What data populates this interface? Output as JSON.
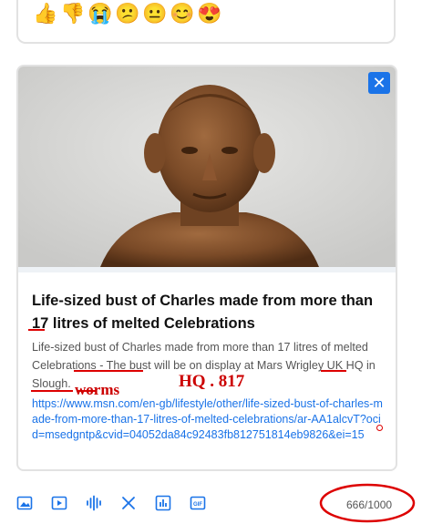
{
  "reactions": [
    {
      "name": "thumbs-up",
      "glyph": "👍"
    },
    {
      "name": "thumbs-down",
      "glyph": "👎"
    },
    {
      "name": "crying",
      "glyph": "😭"
    },
    {
      "name": "confused",
      "glyph": "😕"
    },
    {
      "name": "neutral",
      "glyph": "😐"
    },
    {
      "name": "smiling",
      "glyph": "😊"
    },
    {
      "name": "heart-eyes",
      "glyph": "😍"
    }
  ],
  "post": {
    "title": "Life-sized bust of Charles made from more than 17 litres of melted Celebrations",
    "description": "Life-sized bust of Charles made from more than 17 litres of melted Celebrations - The bust will be on display at Mars Wrigley UK HQ in Slough.",
    "url": "https://www.msn.com/en-gb/lifestyle/other/life-sized-bust-of-charles-made-from-more-than-17-litres-of-melted-celebrations/ar-AA1alcvT?ocid=msedgntp&cvid=04052da84c92483fb812751814eb9826&ei=15",
    "close_glyph": "✕"
  },
  "annotations": {
    "hq_note": "HQ . 817",
    "worms_note": "worms"
  },
  "toolbar": {
    "tools": [
      "image",
      "video",
      "audio",
      "close",
      "chart",
      "gif"
    ]
  },
  "counter": "666/1000",
  "colors": {
    "accent": "#1a73e8",
    "annotation": "#d00000",
    "border": "#e2e2e2"
  }
}
